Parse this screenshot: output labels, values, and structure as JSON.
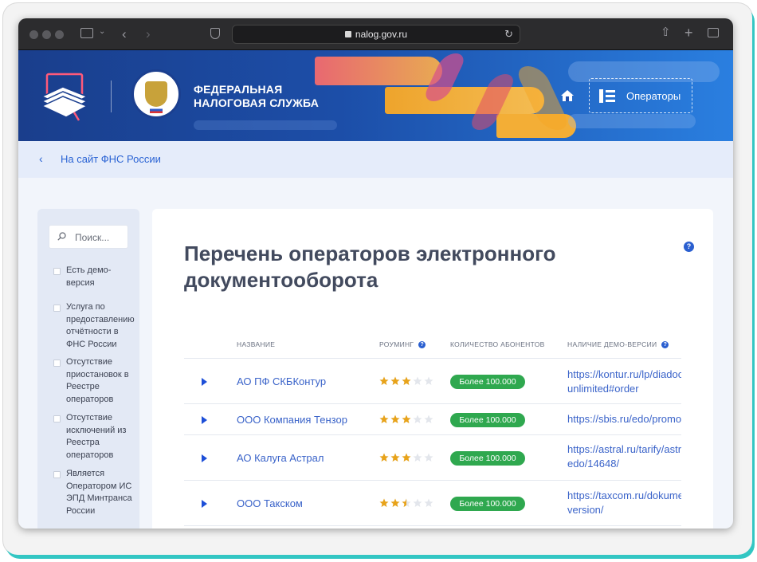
{
  "browser": {
    "url": "nalog.gov.ru"
  },
  "header": {
    "org_name_line1": "ФЕДЕРАЛЬНАЯ",
    "org_name_line2": "НАЛОГОВАЯ СЛУЖБА",
    "emblem_text": "ФЕДЕРАЛЬНАЯ НАЛОГОВАЯ СЛУЖБА",
    "operators_label": "Операторы"
  },
  "backlink": {
    "label": "На сайт ФНС России"
  },
  "sidebar": {
    "search_placeholder": "Поиск...",
    "filters": [
      {
        "label": "Есть демо-версия"
      },
      {
        "label": "Услуга по предоставлению отчётности в ФНС России"
      },
      {
        "label": "Отсутствие приостановок в Реестре операторов"
      },
      {
        "label": "Отсутствие исключений из Реестра операторов"
      },
      {
        "label": "Является Оператором ИС ЭПД Минтранса России"
      }
    ]
  },
  "main": {
    "title": "Перечень операторов электронного документооборота",
    "columns": {
      "name": "НАЗВАНИЕ",
      "roaming": "РОУМИНГ",
      "subscribers": "КОЛИЧЕСТВО АБОНЕНТОВ",
      "demo": "НАЛИЧИЕ ДЕМО-ВЕРСИИ"
    },
    "rows": [
      {
        "name": "АО ПФ СКБКонтур",
        "rating": 3,
        "subscribers": "Более 100.000",
        "demo_line1": "https://kontur.ru/lp/diadoc-",
        "demo_line2": "unlimited#order"
      },
      {
        "name": "ООО Компания Тензор",
        "rating": 3,
        "subscribers": "Более 100.000",
        "demo_line1": "https://sbis.ru/edo/promo",
        "demo_line2": ""
      },
      {
        "name": "АО Калуга Астрал",
        "rating": 3,
        "subscribers": "Более 100.000",
        "demo_line1": "https://astral.ru/tarify/astral-",
        "demo_line2": "edo/14648/"
      },
      {
        "name": "ООО Такском",
        "rating": 2.5,
        "subscribers": "Более 100.000",
        "demo_line1": "https://taxcom.ru/dokumentooborot-",
        "demo_line2": "version/"
      }
    ]
  },
  "colors": {
    "accent": "#2a63d4",
    "badge": "#2fa84f",
    "star": "#e8a31a",
    "star_empty": "#e3e6ec",
    "frame_accent": "#33c6c3"
  }
}
